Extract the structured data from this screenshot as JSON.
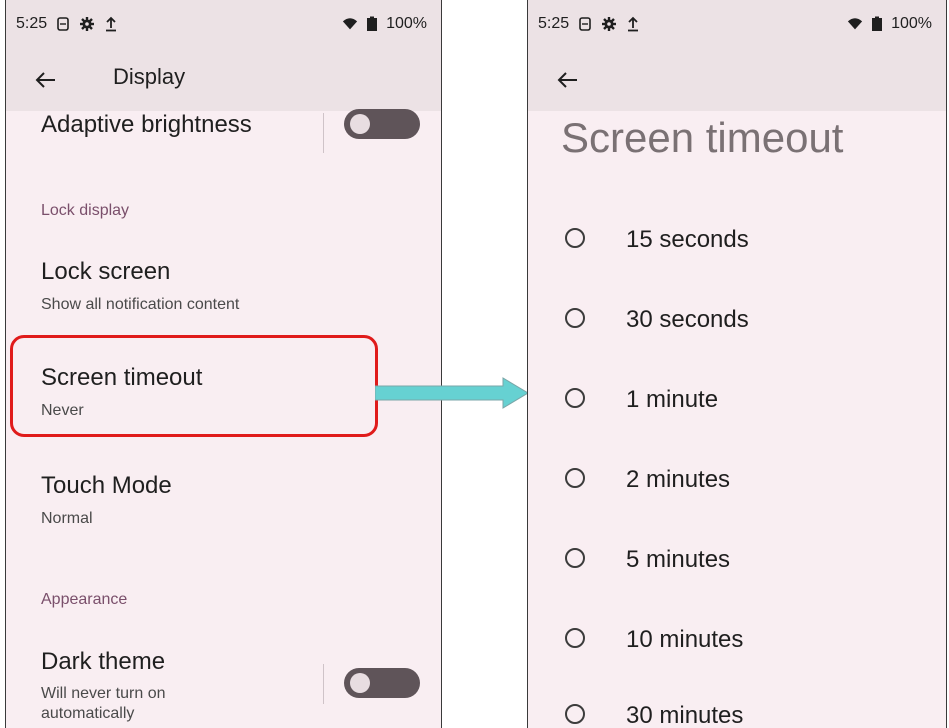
{
  "status": {
    "time": "5:25",
    "battery": "100%",
    "icons": [
      "sim-icon",
      "gear-icon",
      "upload-icon",
      "wifi-icon",
      "battery-icon"
    ]
  },
  "left": {
    "title": "Display",
    "adaptive_brightness": "Adaptive brightness",
    "lock_display_header": "Lock display",
    "lock_screen": {
      "title": "Lock screen",
      "summary": "Show all notification content"
    },
    "screen_timeout": {
      "title": "Screen timeout",
      "summary": "Never"
    },
    "touch_mode": {
      "title": "Touch Mode",
      "summary": "Normal"
    },
    "appearance_header": "Appearance",
    "dark_theme": {
      "title": "Dark theme",
      "summary_line1": "Will never turn on",
      "summary_line2": "automatically"
    }
  },
  "right": {
    "title": "Screen timeout",
    "options": [
      "15 seconds",
      "30 seconds",
      "1 minute",
      "2 minutes",
      "5 minutes",
      "10 minutes",
      "30 minutes"
    ]
  },
  "colors": {
    "highlight": "#e01b1b",
    "arrow": "#66d1d2",
    "screen_bg": "#f9eef2",
    "bar_bg": "#ece2e5"
  }
}
